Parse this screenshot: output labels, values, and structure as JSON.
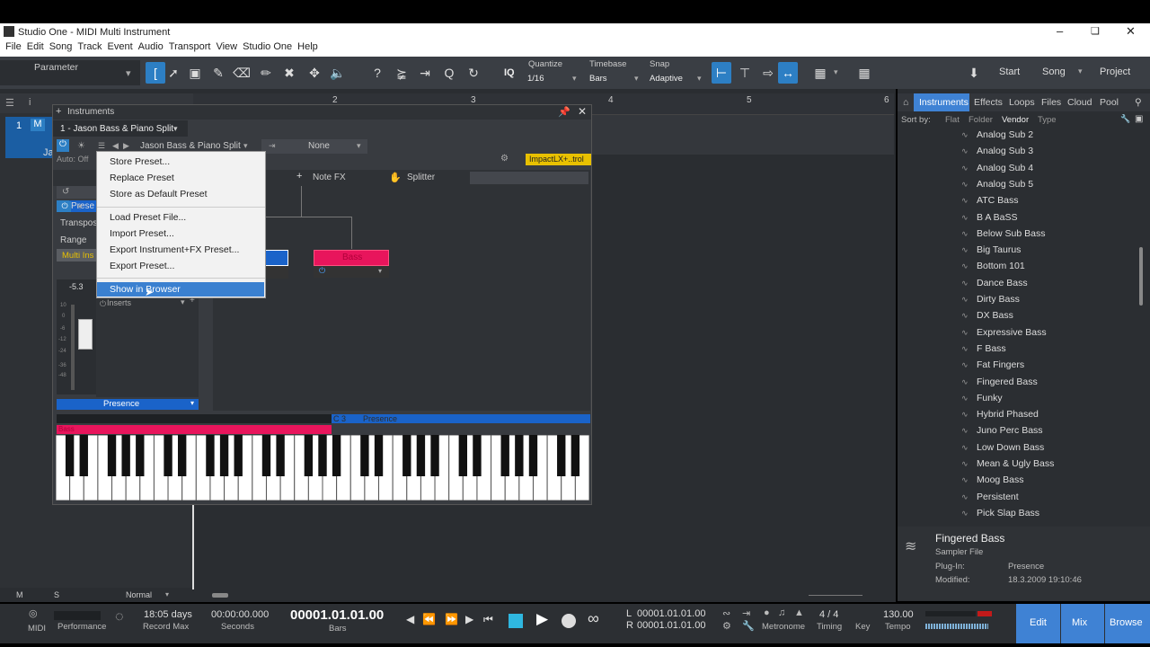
{
  "title": "Studio One - MIDI Multi Instrument",
  "menu": [
    "File",
    "Edit",
    "Song",
    "Track",
    "Event",
    "Audio",
    "Transport",
    "View",
    "Studio One",
    "Help"
  ],
  "toolbar": {
    "parameter_label": "Parameter",
    "iq": "IQ",
    "quantize_label": "Quantize",
    "quantize_value": "1/16",
    "timebase_label": "Timebase",
    "timebase_value": "Bars",
    "snap_label": "Snap",
    "snap_value": "Adaptive",
    "start": "Start",
    "song": "Song",
    "project": "Project"
  },
  "ruler": [
    "2",
    "3",
    "4",
    "5",
    "6"
  ],
  "track": {
    "number": "1",
    "m": "M",
    "name": "Ja"
  },
  "instruments": {
    "header": "Instruments",
    "tab": "1 - Jason Bass & Piano Split",
    "preset_name": "Jason Bass & Piano Split",
    "none": "None",
    "auto": "Auto: Off",
    "impact": "ImpactLX+..trol",
    "note_fx": "Note FX",
    "splitter": "Splitter",
    "transpose": "Transpos",
    "range": "Range",
    "multi": "Multi Ins",
    "prese": "Prese",
    "fader_value": "-5.3",
    "inserts": "Inserts",
    "presence_left": "Presence",
    "bass_module": "Bass",
    "kb_bass": "Bass",
    "kb_c3": "C 3",
    "kb_presence": "Presence",
    "fader_scale": [
      "10",
      "0",
      "-6",
      "-12",
      "-24",
      "-36",
      "-48"
    ]
  },
  "context_menu": {
    "items": [
      "Store Preset...",
      "Replace Preset",
      "Store as Default Preset",
      "Load Preset File...",
      "Import Preset...",
      "Export Instrument+FX Preset...",
      "Export Preset...",
      "Show in Browser"
    ],
    "selected": "Show in Browser"
  },
  "browser": {
    "tabs": [
      "Instruments",
      "Effects",
      "Loops",
      "Files",
      "Cloud",
      "Pool"
    ],
    "sort_label": "Sort by:",
    "sort_opts": [
      "Flat",
      "Folder",
      "Vendor",
      "Type"
    ],
    "items": [
      "Analog Sub 2",
      "Analog Sub 3",
      "Analog Sub 4",
      "Analog Sub 5",
      "ATC Bass",
      "B A BaSS",
      "Below Sub Bass",
      "Big Taurus",
      "Bottom 101",
      "Dance Bass",
      "Dirty Bass",
      "DX Bass",
      "Expressive Bass",
      "F Bass",
      "Fat Fingers",
      "Fingered Bass",
      "Funky",
      "Hybrid Phased",
      "Juno Perc Bass",
      "Low Down Bass",
      "Mean & Ugly Bass",
      "Moog Bass",
      "Persistent",
      "Pick Slap Bass"
    ],
    "info": {
      "name": "Fingered Bass",
      "type": "Sampler File",
      "plugin_label": "Plug-In:",
      "plugin_value": "Presence",
      "modified_label": "Modified:",
      "modified_value": "18.3.2009 19:10:46"
    }
  },
  "bottom": {
    "m": "M",
    "s": "S",
    "normal": "Normal"
  },
  "transport": {
    "midi": "MIDI",
    "performance": "Performance",
    "days": "18:05 days",
    "record_max": "Record Max",
    "seconds_val": "00:00:00.000",
    "seconds": "Seconds",
    "bars_val": "00001.01.01.00",
    "bars": "Bars",
    "l": "L",
    "r": "R",
    "l_val": "00001.01.01.00",
    "r_val": "00001.01.01.00",
    "metronome": "Metronome",
    "timing_val": "4 / 4",
    "timing": "Timing",
    "key": "Key",
    "tempo_val": "130.00",
    "tempo": "Tempo",
    "edit": "Edit",
    "mix": "Mix",
    "browse": "Browse"
  },
  "colors": {
    "accent": "#3f82d4",
    "bass": "#e8155c",
    "presence": "#1a63c9",
    "impact": "#e8c000"
  }
}
